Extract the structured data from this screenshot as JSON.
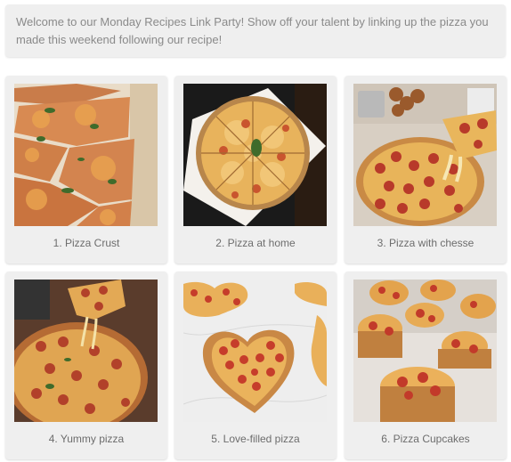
{
  "intro": {
    "text": "Welcome to our Monday Recipes Link Party! Show off your talent by linking up the pizza you made this weekend following our recipe!"
  },
  "entries": [
    {
      "caption": "1. Pizza Crust"
    },
    {
      "caption": "2. Pizza at home"
    },
    {
      "caption": "3. Pizza with chesse"
    },
    {
      "caption": "4. Yummy pizza"
    },
    {
      "caption": "5. Love-filled pizza"
    },
    {
      "caption": "6. Pizza Cupcakes"
    }
  ]
}
